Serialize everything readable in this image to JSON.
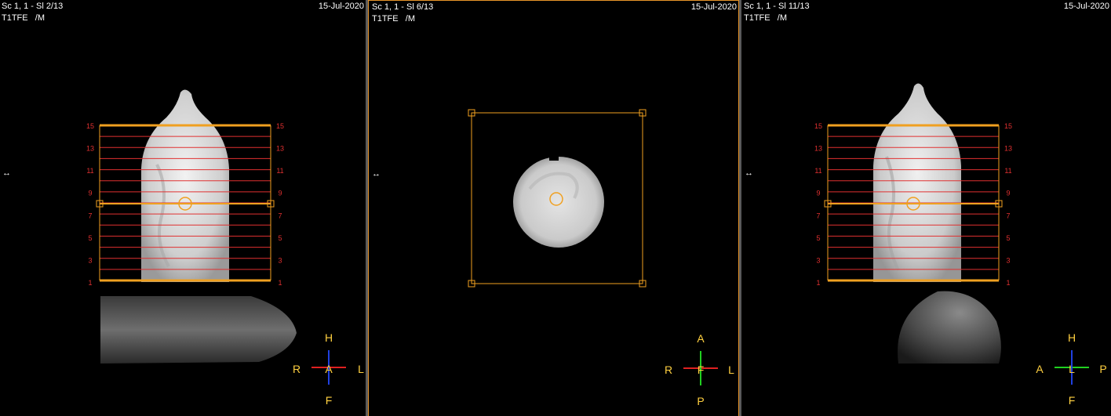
{
  "viewports": [
    {
      "series": "Sc 1, 1 - Sl 2/13",
      "sequence": "T1TFE   /M",
      "date": "15-Jul-2020",
      "pan_glyph": "↔",
      "slice_labels": [
        "15",
        "13",
        "11",
        "9",
        "7",
        "5",
        "3",
        "1"
      ],
      "orientation": {
        "top": "H",
        "bottom": "F",
        "left": "R",
        "right": "L",
        "center": "A"
      }
    },
    {
      "series": "Sc 1, 1 - Sl 6/13",
      "sequence": "T1TFE   /M",
      "date": "15-Jul-2020",
      "pan_glyph": "↔",
      "orientation": {
        "top": "A",
        "bottom": "P",
        "left": "R",
        "right": "L",
        "center": "F"
      }
    },
    {
      "series": "Sc 1, 1 - Sl 11/13",
      "sequence": "T1TFE   /M",
      "date": "15-Jul-2020",
      "pan_glyph": "↔",
      "slice_labels": [
        "15",
        "13",
        "11",
        "9",
        "7",
        "5",
        "3",
        "1"
      ],
      "orientation": {
        "top": "H",
        "bottom": "F",
        "left": "A",
        "right": "P",
        "center": "L"
      }
    }
  ],
  "colors": {
    "overlay_orange": "#f0a020",
    "slice_lines": "#e03030",
    "slice_label": "#e03030",
    "axis_red": "#e02020",
    "axis_blue": "#2040e0",
    "axis_green": "#20d020",
    "orientation_text": "#ffd040"
  }
}
